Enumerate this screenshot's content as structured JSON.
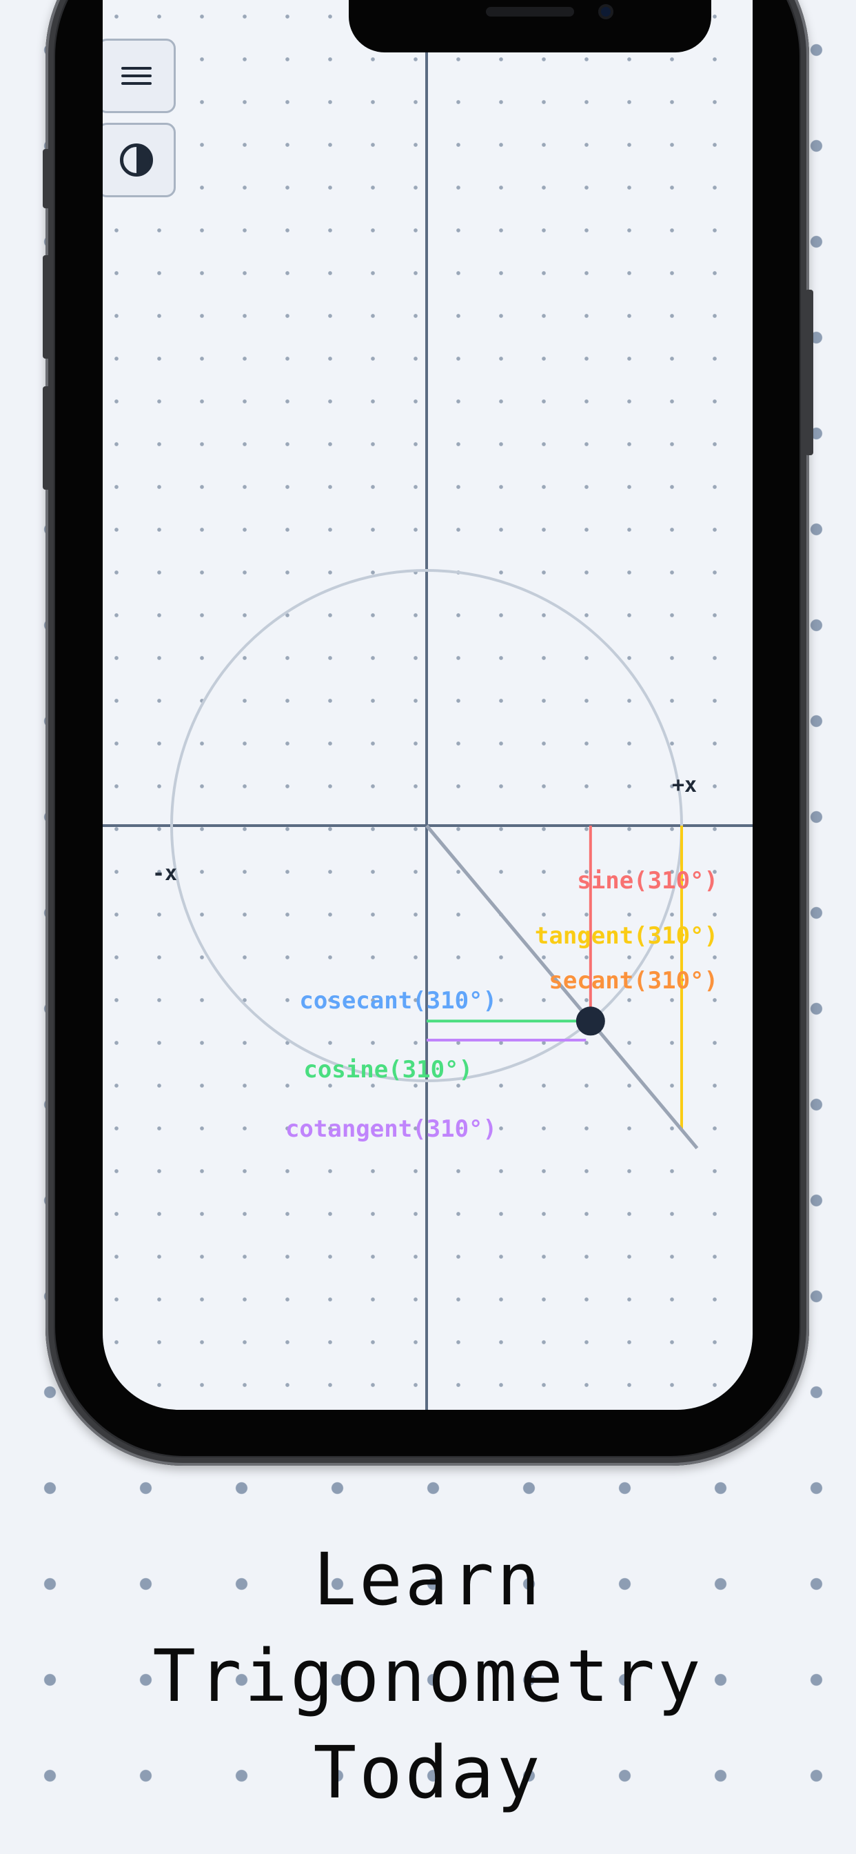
{
  "app": {
    "menu_icon": "hamburger-menu-icon",
    "theme_icon": "contrast-toggle-icon"
  },
  "unit_circle": {
    "angle_deg": 310,
    "axis_labels": {
      "positive_x": "+x",
      "negative_x": "-x"
    },
    "function_labels": {
      "sine": "sine(310°)",
      "tangent": "tangent(310°)",
      "secant": "secant(310°)",
      "cosecant": "cosecant(310°)",
      "cosine": "cosine(310°)",
      "cotangent": "cotangent(310°)"
    },
    "colors": {
      "sine": "#f87171",
      "tangent": "#facc15",
      "secant": "#fb923c",
      "cosecant": "#60a5fa",
      "cosine": "#4ade80",
      "cotangent": "#c084fc",
      "axis": "#5b6b82",
      "circle": "#c3ccd8",
      "point": "#1e293b"
    }
  },
  "tagline": {
    "line1": "Learn",
    "line2": "Trigonometry",
    "line3": "Today"
  }
}
